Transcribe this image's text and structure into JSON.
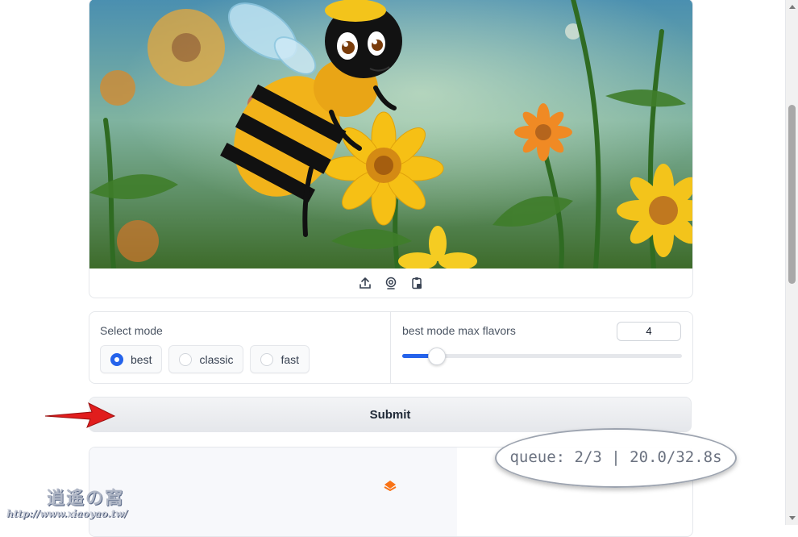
{
  "image_panel": {
    "alt": "Cartoon bee on a yellow flower in a sunny meadow",
    "tools": [
      {
        "name": "upload-icon",
        "title": "Upload"
      },
      {
        "name": "webcam-icon",
        "title": "Webcam"
      },
      {
        "name": "clipboard-icon",
        "title": "Paste from clipboard"
      }
    ]
  },
  "mode": {
    "label": "Select mode",
    "options": [
      "best",
      "classic",
      "fast"
    ],
    "selected": "best"
  },
  "flavors": {
    "label": "best mode max flavors",
    "value": "4",
    "slider_fraction": 0.12
  },
  "submit": {
    "label": "Submit"
  },
  "output": {
    "queue_status": "queue: 2/3 | 20.0/32.8s",
    "spinner_color": "#f97316"
  },
  "watermark": {
    "logo": "逍遙の窩",
    "url": "http://www.xiaoyao.tw/"
  },
  "colors": {
    "accent": "#2563eb",
    "annotation_arrow": "#e11d1d"
  }
}
